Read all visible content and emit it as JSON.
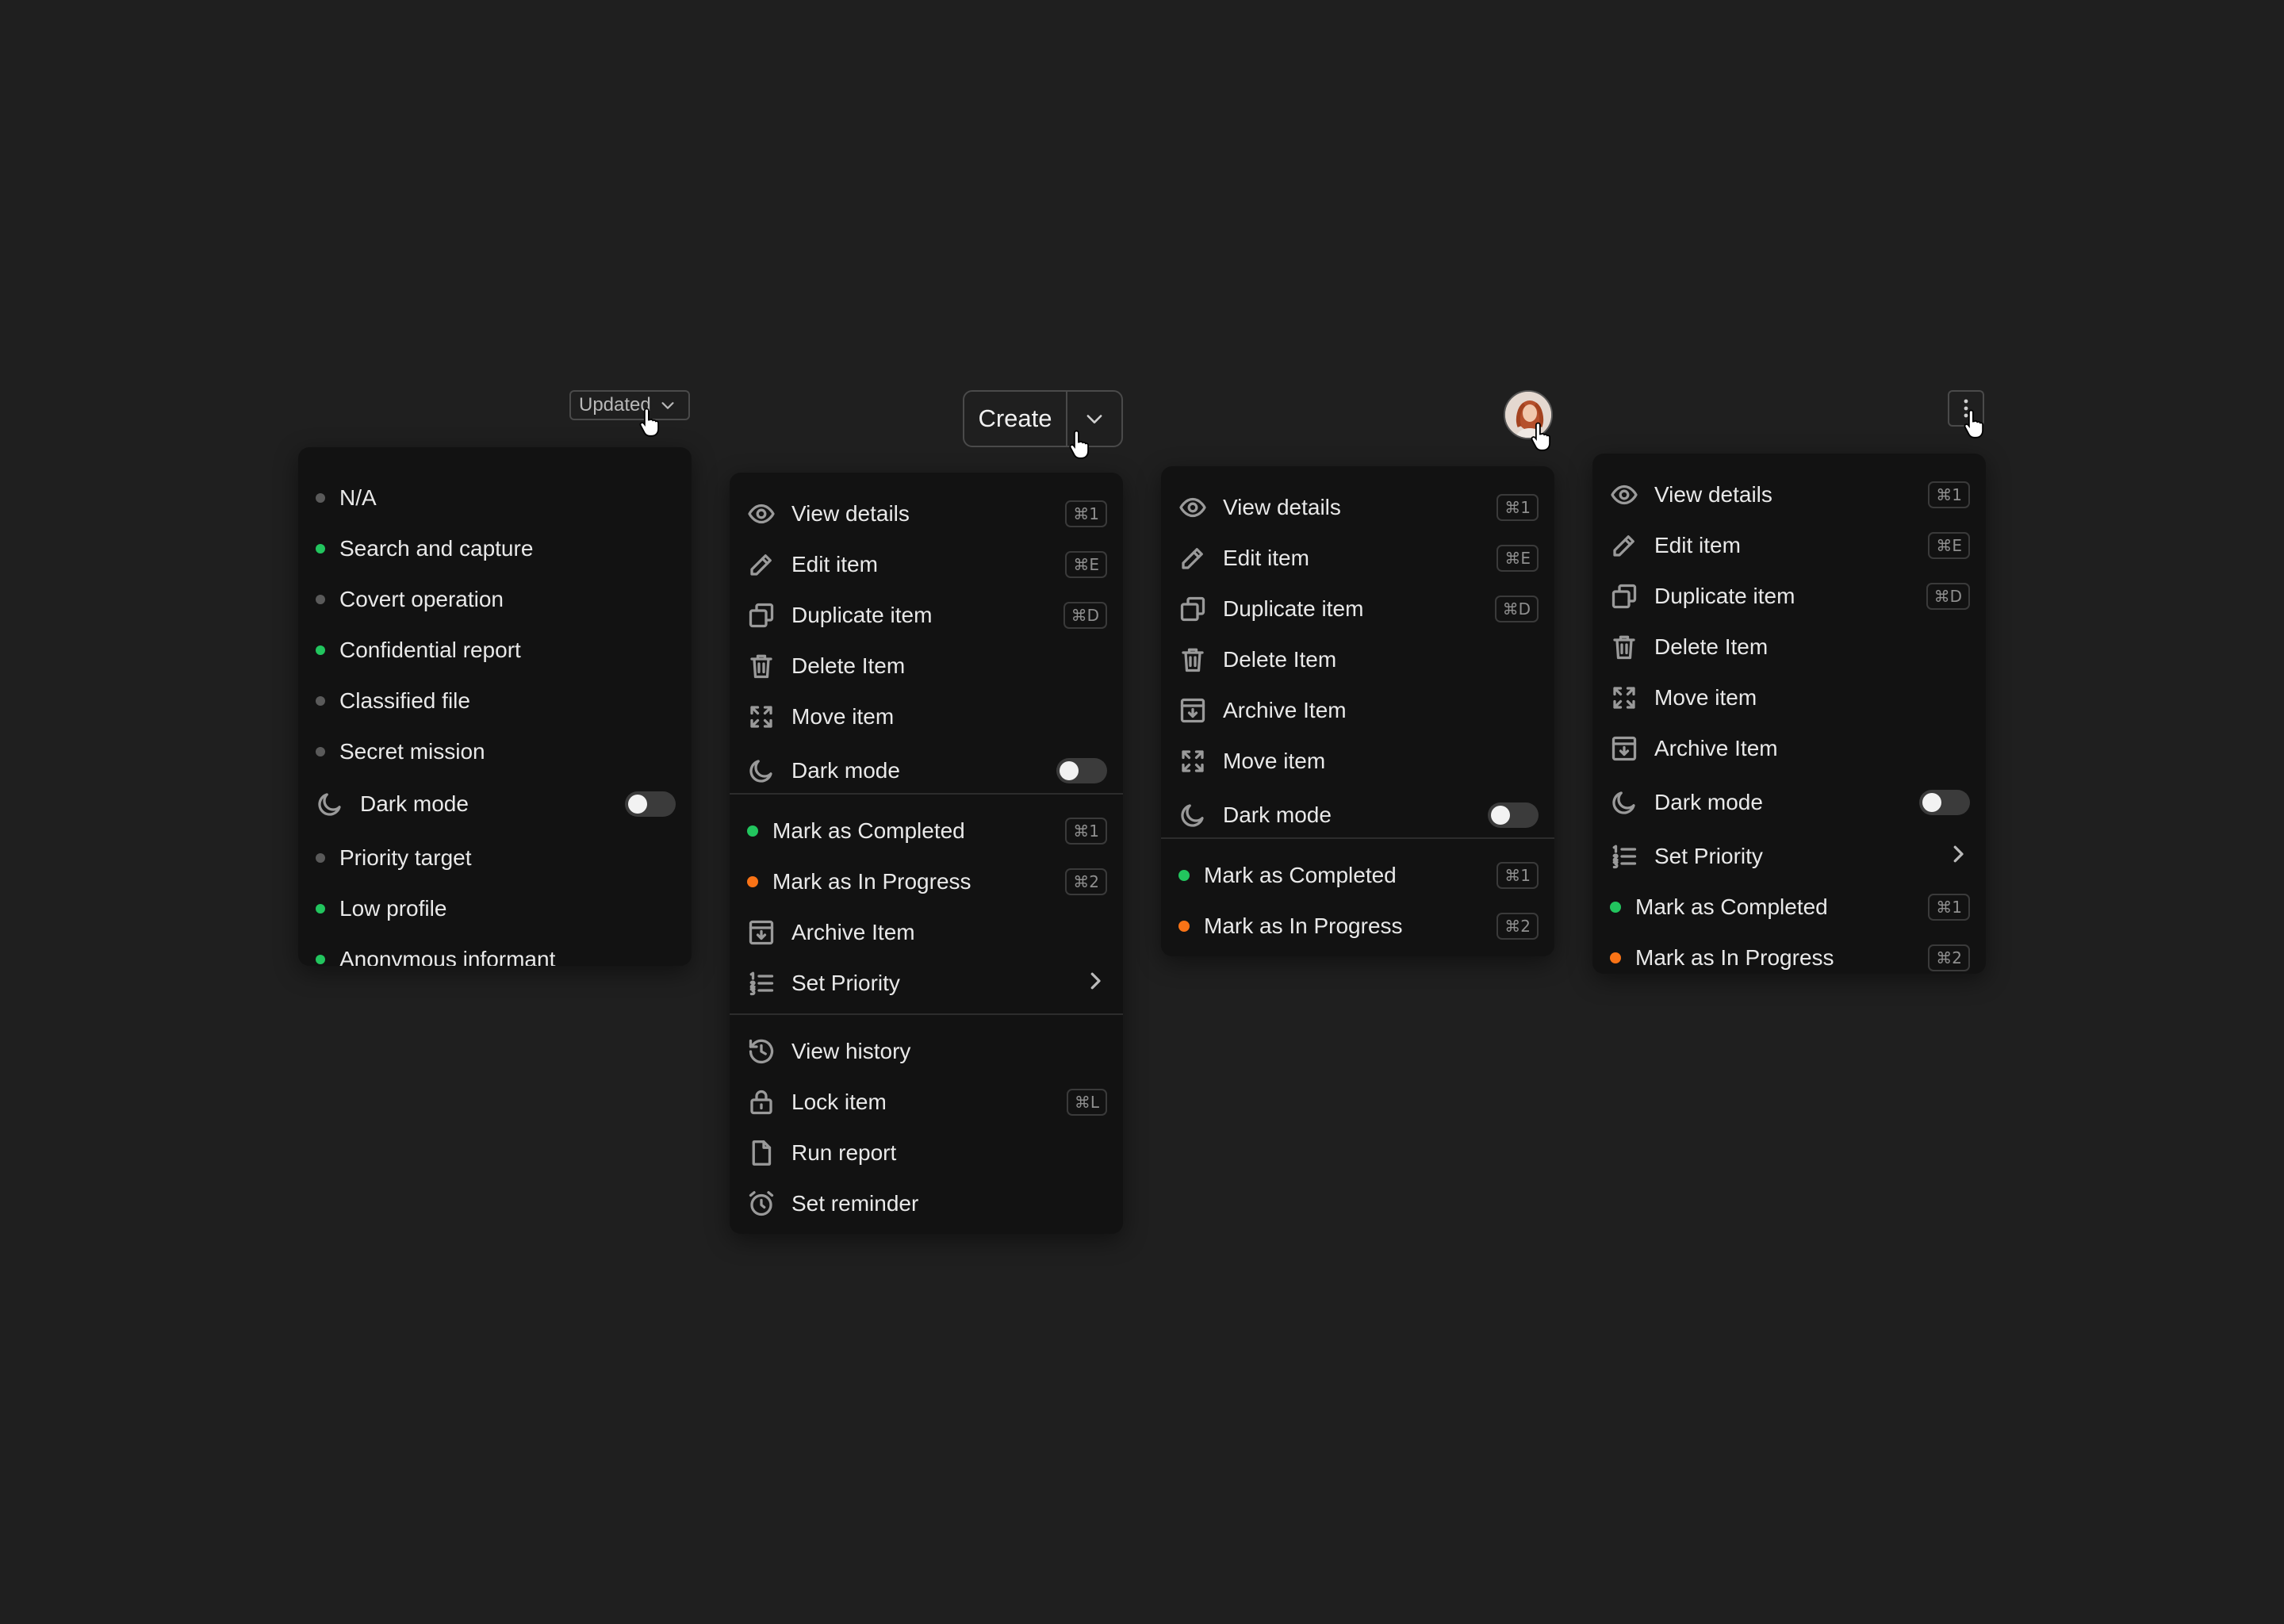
{
  "colors": {
    "green": "#22c55e",
    "orange": "#f97316",
    "gray": "#5a5a5a"
  },
  "updated_button": {
    "label": "Updated"
  },
  "create_button": {
    "label": "Create"
  },
  "menu1": {
    "items": [
      {
        "label": "N/A",
        "status": "gray"
      },
      {
        "label": "Search and capture",
        "status": "green"
      },
      {
        "label": "Covert operation",
        "status": "gray"
      },
      {
        "label": "Confidential report",
        "status": "green"
      },
      {
        "label": "Classified file",
        "status": "gray"
      },
      {
        "label": "Secret mission",
        "status": "gray"
      },
      {
        "label": "Dark mode",
        "icon": "moon-icon",
        "toggle": "off"
      },
      {
        "label": "Priority target",
        "status": "gray"
      },
      {
        "label": "Low profile",
        "status": "green"
      },
      {
        "label": "Anonymous informant",
        "status": "green"
      }
    ]
  },
  "menu2": {
    "items": [
      {
        "label": "View details",
        "icon": "eye-icon",
        "shortcut": "⌘1"
      },
      {
        "label": "Edit item",
        "icon": "pencil-icon",
        "shortcut": "⌘E"
      },
      {
        "label": "Duplicate item",
        "icon": "duplicate-icon",
        "shortcut": "⌘D"
      },
      {
        "label": "Delete Item",
        "icon": "trash-icon"
      },
      {
        "label": "Move item",
        "icon": "move-icon"
      },
      {
        "label": "Dark mode",
        "icon": "moon-icon",
        "toggle": "off"
      },
      {
        "label": "Mark as Completed",
        "status": "green",
        "shortcut": "⌘1"
      },
      {
        "label": "Mark as In Progress",
        "status": "orange",
        "shortcut": "⌘2"
      },
      {
        "label": "Archive Item",
        "icon": "archive-icon"
      },
      {
        "label": "Set Priority",
        "icon": "list-icon",
        "submenu": true
      },
      {
        "label": "View history",
        "icon": "history-icon"
      },
      {
        "label": "Lock item",
        "icon": "lock-icon",
        "shortcut": "⌘L"
      },
      {
        "label": "Run report",
        "icon": "file-icon"
      },
      {
        "label": "Set reminder",
        "icon": "alarm-icon"
      }
    ]
  },
  "menu3": {
    "items": [
      {
        "label": "View details",
        "icon": "eye-icon",
        "shortcut": "⌘1"
      },
      {
        "label": "Edit item",
        "icon": "pencil-icon",
        "shortcut": "⌘E"
      },
      {
        "label": "Duplicate item",
        "icon": "duplicate-icon",
        "shortcut": "⌘D"
      },
      {
        "label": "Delete Item",
        "icon": "trash-icon"
      },
      {
        "label": "Archive Item",
        "icon": "archive-icon"
      },
      {
        "label": "Move item",
        "icon": "move-icon"
      },
      {
        "label": "Dark mode",
        "icon": "moon-icon",
        "toggle": "off"
      },
      {
        "label": "Mark as Completed",
        "status": "green",
        "shortcut": "⌘1"
      },
      {
        "label": "Mark as In Progress",
        "status": "orange",
        "shortcut": "⌘2"
      }
    ]
  },
  "menu4": {
    "items": [
      {
        "label": "View details",
        "icon": "eye-icon",
        "shortcut": "⌘1"
      },
      {
        "label": "Edit item",
        "icon": "pencil-icon",
        "shortcut": "⌘E"
      },
      {
        "label": "Duplicate item",
        "icon": "duplicate-icon",
        "shortcut": "⌘D"
      },
      {
        "label": "Delete Item",
        "icon": "trash-icon"
      },
      {
        "label": "Move item",
        "icon": "move-icon"
      },
      {
        "label": "Archive Item",
        "icon": "archive-icon"
      },
      {
        "label": "Dark mode",
        "icon": "moon-icon",
        "toggle": "off"
      },
      {
        "label": "Set Priority",
        "icon": "list-icon",
        "submenu": true
      },
      {
        "label": "Mark as Completed",
        "status": "green",
        "shortcut": "⌘1"
      },
      {
        "label": "Mark as In Progress",
        "status": "orange",
        "shortcut": "⌘2"
      }
    ]
  }
}
